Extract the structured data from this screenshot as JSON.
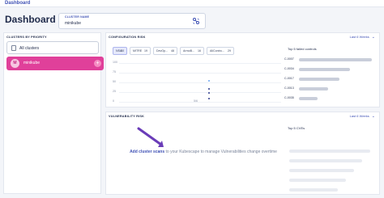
{
  "nav": {
    "breadcrumb": "Dashboard"
  },
  "header": {
    "title": "Dashboard",
    "cluster_select": {
      "label": "CLUSTER NAME",
      "value": "minikube",
      "icon": "cluster-switch-icon"
    }
  },
  "clusters_panel": {
    "title": "CLUSTERS BY PRIORITY",
    "all_label": "All clusters",
    "items": [
      {
        "avatar": "M",
        "name": "minikube",
        "color": "#e0409a"
      }
    ]
  },
  "config_risk": {
    "title": "CONFIGURATION RISK",
    "period": "Last 6 Weeks",
    "frameworks": [
      {
        "name": "NSA",
        "value": "50",
        "selected": true
      },
      {
        "name": "MITRE",
        "value": "19",
        "selected": false
      },
      {
        "name": "DevOp...",
        "value": "48",
        "selected": false
      },
      {
        "name": "ArmoB...",
        "value": "16",
        "selected": false
      },
      {
        "name": "AllContro...",
        "value": "29",
        "selected": false
      }
    ],
    "y_ticks": [
      "100",
      "75",
      "50",
      "25",
      "0"
    ],
    "x_label": "5/6",
    "points": [
      {
        "label": "",
        "value": 57,
        "color": "#6aa6f0"
      },
      {
        "label": "",
        "value": 35,
        "color": "#2d3a8c"
      },
      {
        "label": "",
        "value": 25,
        "color": "#2d3a8c"
      },
      {
        "label": "",
        "value": 10,
        "color": "#2d3a8c"
      }
    ],
    "top_failed": {
      "title": "Top 5 failed controls",
      "controls": [
        {
          "id": "C-0007",
          "value": 1.0
        },
        {
          "id": "C-0034",
          "value": 0.7
        },
        {
          "id": "C-0017",
          "value": 0.55
        },
        {
          "id": "C-0013",
          "value": 0.4
        },
        {
          "id": "C-0035",
          "value": 0.25
        }
      ]
    }
  },
  "vuln_risk": {
    "title": "VULNERABILITY RISK",
    "period": "Last 6 Weeks",
    "cta_link": "Add cluster scans",
    "cta_text": " to your Kubescape to manage Vulnerabilities change overtime",
    "top_cves_title": "Top 5 CVEs",
    "cve_placeholders": [
      1.0,
      0.9,
      0.8,
      0.7,
      0.6
    ]
  },
  "colors": {
    "accent": "#3f51b5",
    "cluster": "#e0409a"
  }
}
